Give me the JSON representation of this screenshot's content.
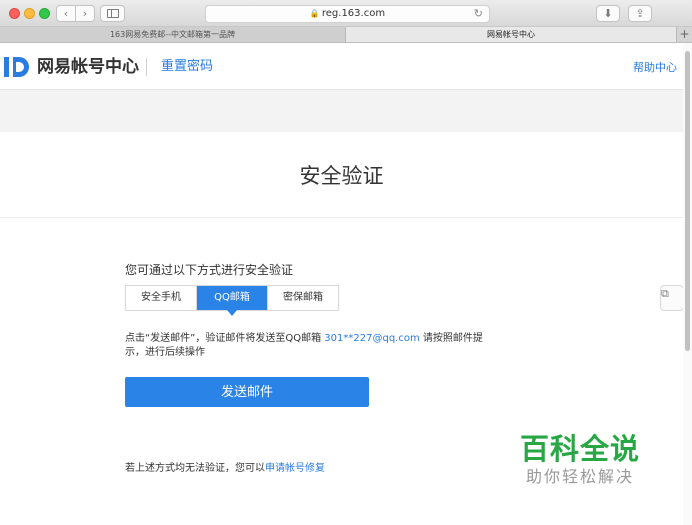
{
  "browser": {
    "url": "reg.163.com",
    "tabs": [
      {
        "label": "163网易免费邮--中文邮箱第一品牌"
      },
      {
        "label": "网易帐号中心"
      }
    ]
  },
  "header": {
    "site_name": "网易帐号中心",
    "subpage": "重置密码",
    "help": "帮助中心",
    "logo_color": "#2a7ce0"
  },
  "main": {
    "title": "安全验证",
    "prompt": "您可通过以下方式进行安全验证",
    "methods": [
      {
        "label": "安全手机",
        "active": false
      },
      {
        "label": "QQ邮箱",
        "active": true
      },
      {
        "label": "密保邮箱",
        "active": false
      }
    ],
    "info_prefix": "点击“发送邮件”，验证邮件将发送至QQ邮箱",
    "email": "301**227@qq.com",
    "info_suffix": "请按照邮件提示，进行后续操作",
    "send_label": "发送邮件",
    "footer_prefix": "若上述方式均无法验证，您可以",
    "footer_link": "申请帐号修复"
  },
  "watermark": {
    "main": "百科全说",
    "sub": "助你轻松解决"
  },
  "colors": {
    "accent": "#2a83e6",
    "watermark": "#28a745"
  }
}
